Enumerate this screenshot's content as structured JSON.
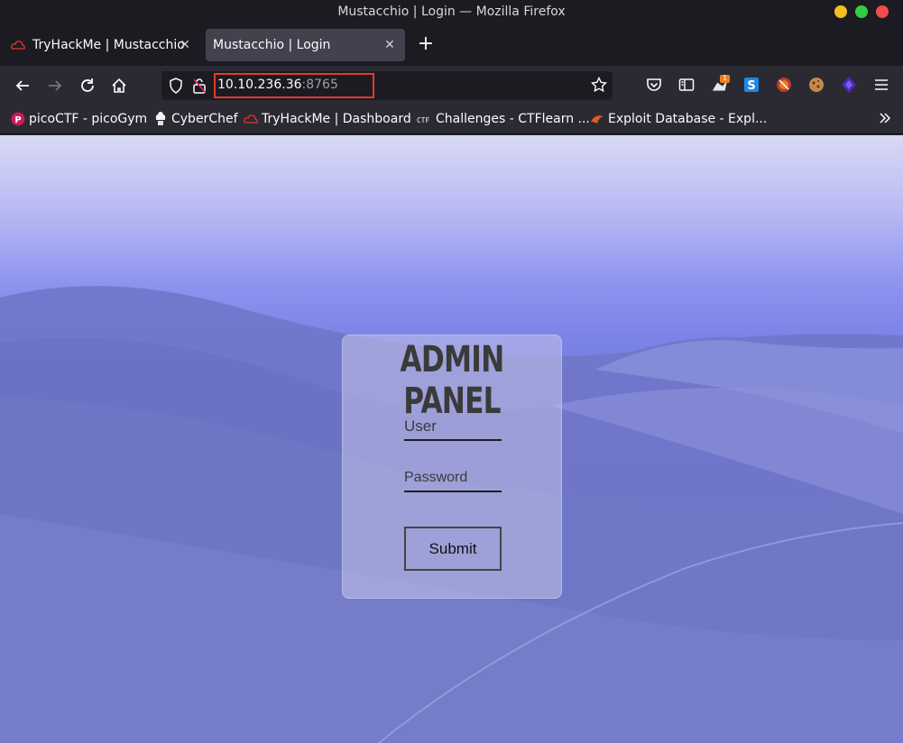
{
  "window": {
    "title": "Mustacchio | Login — Mozilla Firefox"
  },
  "tabs": [
    {
      "label": "TryHackMe | Mustacchio",
      "icon": "tryhackme-icon",
      "active": false
    },
    {
      "label": "Mustacchio | Login",
      "active": true
    }
  ],
  "urlbar": {
    "host": "10.10.236.36",
    "port": ":8765",
    "highlight_color": "#e33a2f"
  },
  "toolbar_badge": {
    "count": "1"
  },
  "bookmarks": [
    {
      "label": "picoCTF - picoGym",
      "icon": "picoctf-icon"
    },
    {
      "label": "CyberChef",
      "icon": "cyberchef-icon"
    },
    {
      "label": "TryHackMe | Dashboard",
      "icon": "tryhackme-icon"
    },
    {
      "label": "Challenges - CTFlearn ...",
      "icon": "ctf-icon"
    },
    {
      "label": "Exploit Database - Expl...",
      "icon": "exploitdb-icon"
    }
  ],
  "page": {
    "panel_title": "ADMIN PANEL",
    "user_placeholder": "User",
    "password_placeholder": "Password",
    "submit_label": "Submit"
  },
  "colors": {
    "chrome_dark": "#1c1b22",
    "chrome": "#2b2a33",
    "tab_active": "#42414d"
  }
}
